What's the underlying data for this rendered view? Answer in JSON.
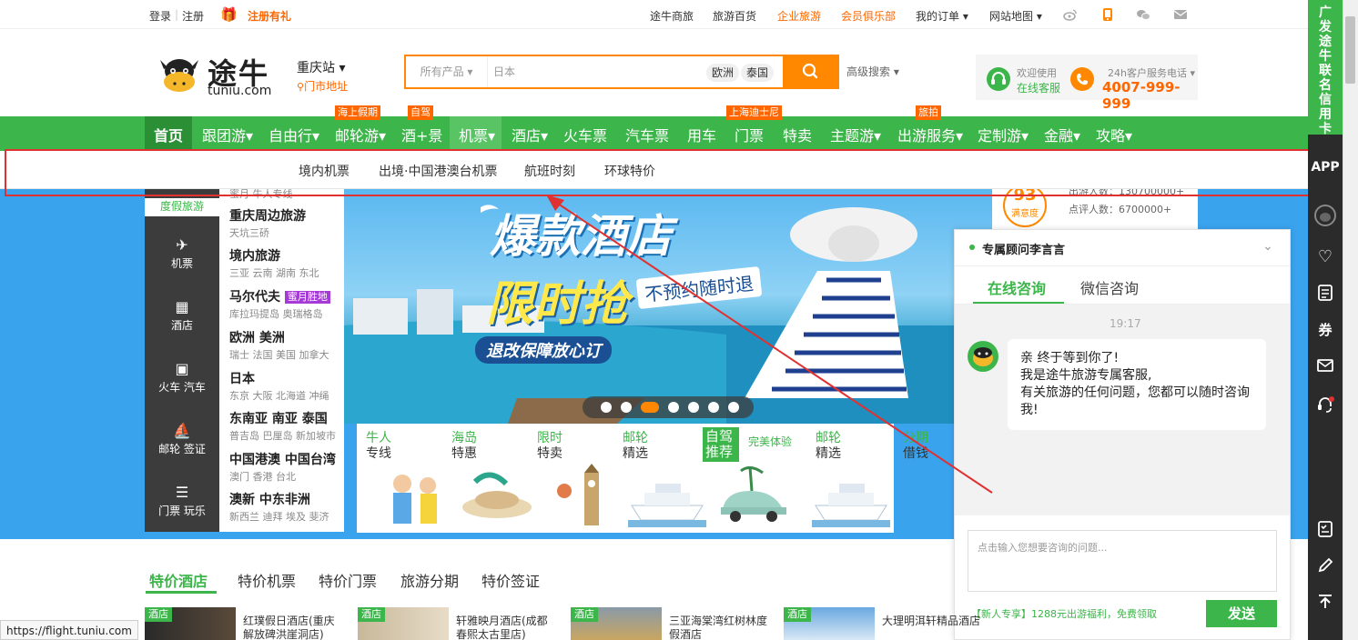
{
  "topbar": {
    "login": "登录",
    "sep": "|",
    "register": "注册",
    "register_gift": "注册有礼",
    "links": [
      "途牛商旅",
      "旅游百货",
      "企业旅游",
      "会员俱乐部",
      "我的订单 ▾",
      "网站地图 ▾"
    ]
  },
  "header": {
    "logo_text": "途牛",
    "logo_url": "tuniu.com",
    "station": "重庆站 ▾",
    "store": "门市地址",
    "search_category": "所有产品 ▾",
    "search_value": "日本",
    "search_tags": [
      "欧洲",
      "泰国"
    ],
    "advanced": "高级搜索 ▾",
    "service_line1": "欢迎使用",
    "service_line2": "在线客服",
    "hotline_label": "24h客户服务电话 ▾",
    "hotline": "4007-999-999"
  },
  "nav": {
    "items": [
      "首页",
      "跟团游▾",
      "自由行▾",
      "邮轮游▾",
      "酒+景",
      "机票▾",
      "酒店▾",
      "火车票",
      "汽车票",
      "用车",
      "门票",
      "特卖",
      "主题游▾",
      "出游服务▾",
      "定制游▾",
      "金融▾",
      "攻略▾"
    ],
    "flyers": [
      "海上假期",
      "自驾",
      "上海迪士尼",
      "旅拍"
    ]
  },
  "dropdown": {
    "items": [
      "境内机票",
      "出境·中国港澳台机票",
      "航班时刻",
      "环球特价"
    ]
  },
  "sidecat": {
    "items": [
      "度假旅游",
      "机票",
      "酒店",
      "火车 汽车",
      "邮轮 签证",
      "门票 玩乐"
    ]
  },
  "sidelist": {
    "top_sub": "蜜月  牛人专线",
    "groups": [
      {
        "title": "重庆周边旅游",
        "sub": "天坑三硚"
      },
      {
        "title": "境内旅游",
        "sub": "三亚  云南  湖南  东北"
      },
      {
        "title": "马尔代夫",
        "badge": "蜜月胜地",
        "sub": "库拉玛提岛  奥瑞格岛"
      },
      {
        "title": "欧洲  美洲",
        "sub": "瑞士  法国  美国  加拿大"
      },
      {
        "title": "日本",
        "sub": "东京  大阪  北海道  冲绳"
      },
      {
        "title": "东南亚  南亚  泰国",
        "sub": "普吉岛  巴厘岛  新加坡市"
      },
      {
        "title": "中国港澳  中国台湾",
        "sub": "澳门  香港  台北"
      },
      {
        "title": "澳新  中东非洲",
        "sub": "新西兰  迪拜  埃及  斐济"
      }
    ]
  },
  "banner": {
    "title": "爆款酒店",
    "subtitle": "限时抢",
    "tag": "不预约随时退",
    "note": "退改保障放心订"
  },
  "promo": {
    "items": [
      {
        "title": "牛人",
        "sub": "专线"
      },
      {
        "title": "海岛",
        "sub": "特惠"
      },
      {
        "title": "限时",
        "sub": "特卖"
      },
      {
        "title": "邮轮",
        "sub": "精选"
      },
      {
        "title": "自驾",
        "sub": "推荐",
        "extra": "完美体验"
      },
      {
        "title": "邮轮",
        "sub": "精选"
      },
      {
        "title": "分期",
        "sub": "借钱"
      }
    ]
  },
  "stats": {
    "score": "93",
    "score_label": "满意度",
    "line1": "出游人数：130700000+",
    "line2": "点评人数：6700000+"
  },
  "chat": {
    "title": "专属顾问李言言",
    "tabs": [
      "在线咨询",
      "微信咨询"
    ],
    "time": "19:17",
    "message": [
      "亲 终于等到你了!",
      "我是途牛旅游专属客服,",
      "有关旅游的任何问题，您都可以随时咨询我!"
    ],
    "placeholder": "点击输入您想要咨询的问题...",
    "promo": "【新人专享】1288元出游福利，免费领取",
    "send": "发送"
  },
  "rbar": {
    "ad": "广发途牛联名信用卡",
    "app": "APP",
    "coupon": "券"
  },
  "bottom": {
    "tabs": [
      "特价酒店",
      "特价机票",
      "特价门票",
      "旅游分期",
      "特价签证"
    ],
    "hotels": [
      {
        "tag": "酒店",
        "name": "红璞假日酒店(重庆解放碑洪崖洞店)"
      },
      {
        "tag": "酒店",
        "name": "轩雅映月酒店(成都春熙太古里店)"
      },
      {
        "tag": "酒店",
        "name": "三亚海棠湾红树林度假酒店"
      },
      {
        "tag": "酒店",
        "name": "大理明洱轩精品酒店"
      }
    ]
  },
  "status_url": "https://flight.tuniu.com"
}
